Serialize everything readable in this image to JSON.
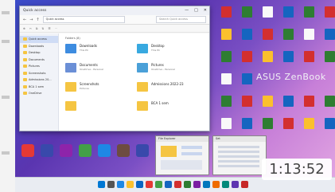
{
  "explorer": {
    "title": "Quick access",
    "controls": [
      "—",
      "□",
      "✕"
    ],
    "address": "Quick access",
    "search_placeholder": "Search Quick access",
    "section": "Folders (8)",
    "nav_items": [
      {
        "label": "Quick access",
        "active": true
      },
      {
        "label": "Downloads"
      },
      {
        "label": "Desktop"
      },
      {
        "label": "Documents"
      },
      {
        "label": "Pictures"
      },
      {
        "label": "Screenshots"
      },
      {
        "label": "Admissions 20..."
      },
      {
        "label": "BCA 1 sem"
      },
      {
        "label": "OneDrive"
      }
    ],
    "tiles": [
      {
        "name": "Downloads",
        "sub": "This PC",
        "color": "#3d8ce0"
      },
      {
        "name": "Desktop",
        "sub": "This PC",
        "color": "#38a9e0"
      },
      {
        "name": "Documents",
        "sub": "OneDrive - Personal",
        "color": "#6b8fd6"
      },
      {
        "name": "Pictures",
        "sub": "OneDrive - Personal",
        "color": "#4aa0d8"
      },
      {
        "name": "Screenshots",
        "sub": "Pictures",
        "color": "#f5c542"
      },
      {
        "name": "Admissions 2022-23",
        "sub": "",
        "color": "#f5c542"
      },
      {
        "name": "",
        "sub": "",
        "color": "#f5c542"
      },
      {
        "name": "BCA 1 sem",
        "sub": "",
        "color": "#f5c542"
      }
    ]
  },
  "desktop": {
    "brand": "ASUS ZenBook"
  },
  "task_view": [
    {
      "title": "File Explorer"
    },
    {
      "title": "Set"
    }
  ],
  "timestamp": "1:13:52"
}
